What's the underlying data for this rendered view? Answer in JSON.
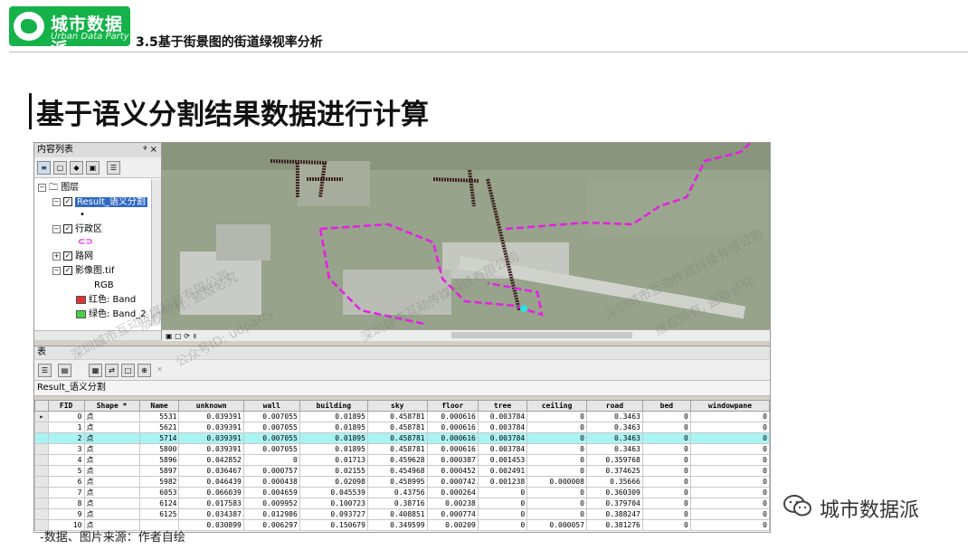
{
  "header": {
    "logo_title": "城市数据派",
    "logo_subtitle": "Urban Data Party",
    "section_title": "3.5基于街景图的街道绿视率分析"
  },
  "main_title": "基于语义分割结果数据进行计算",
  "app": {
    "toc": {
      "title": "内容列表",
      "pin": "ᵠ ×",
      "layers_root": "图层",
      "layer1": "Result_语义分割",
      "layer2": "行政区",
      "layer3": "路网",
      "layer4": "影像图.tif",
      "rgb": "RGB",
      "band_red": "红色:    Band",
      "band_green": "绿色: Band_2"
    },
    "table_panel": {
      "label": "表",
      "name": "Result_语义分割",
      "columns": [
        "FID",
        "Shape *",
        "Name",
        "unknown",
        "wall",
        "building",
        "sky",
        "floor",
        "tree",
        "ceiling",
        "road",
        "bed",
        "windowpane"
      ],
      "rows": [
        [
          "0",
          "点",
          "5531",
          "0.039391",
          "0.007055",
          "0.01895",
          "0.458781",
          "0.000616",
          "0.003784",
          "0",
          "0.3463",
          "0",
          "0"
        ],
        [
          "1",
          "点",
          "5621",
          "0.039391",
          "0.007055",
          "0.01895",
          "0.458781",
          "0.000616",
          "0.003784",
          "0",
          "0.3463",
          "0",
          "0"
        ],
        [
          "2",
          "点",
          "5714",
          "0.039391",
          "0.007055",
          "0.01895",
          "0.458781",
          "0.000616",
          "0.003784",
          "0",
          "0.3463",
          "0",
          "0"
        ],
        [
          "3",
          "点",
          "5800",
          "0.039391",
          "0.007055",
          "0.01895",
          "0.458781",
          "0.000616",
          "0.003784",
          "0",
          "0.3463",
          "0",
          "0"
        ],
        [
          "4",
          "点",
          "5896",
          "0.042852",
          "0",
          "0.01713",
          "0.459628",
          "0.000387",
          "0.001453",
          "0",
          "0.359768",
          "0",
          "0"
        ],
        [
          "5",
          "点",
          "5897",
          "0.036467",
          "0.000757",
          "0.02155",
          "0.454968",
          "0.000452",
          "0.002491",
          "0",
          "0.374625",
          "0",
          "0"
        ],
        [
          "6",
          "点",
          "5982",
          "0.046439",
          "0.000438",
          "0.02098",
          "0.458995",
          "0.000742",
          "0.001238",
          "0.000008",
          "0.35666",
          "0",
          "0"
        ],
        [
          "7",
          "点",
          "6053",
          "0.066039",
          "0.004659",
          "0.045539",
          "0.43756",
          "0.000264",
          "0",
          "0",
          "0.360309",
          "0",
          "0"
        ],
        [
          "8",
          "点",
          "6124",
          "0.017583",
          "0.009952",
          "0.100723",
          "0.38716",
          "0.00238",
          "0",
          "0",
          "0.379704",
          "0",
          "0"
        ],
        [
          "9",
          "点",
          "6125",
          "0.034387",
          "0.012986",
          "0.093727",
          "0.408851",
          "0.000774",
          "0",
          "0",
          "0.388247",
          "0",
          "0"
        ],
        [
          "10",
          "点",
          "",
          "0.030899",
          "0.006297",
          "0.150679",
          "0.349599",
          "0.00209",
          "0",
          "0.000057",
          "0.381276",
          "0",
          "0"
        ]
      ]
    }
  },
  "watermarks": [
    "深圳城市互动传媒科技有限公司",
    "版权所有, 盗版必究",
    "公众号ID: udparty"
  ],
  "caption": "-数据、图片来源：作者自绘",
  "wechat": "城市数据派",
  "colors": {
    "logo_green": "#15b24a",
    "highlight_row": "#aaf3f3",
    "boundary": "#e61ee6"
  }
}
